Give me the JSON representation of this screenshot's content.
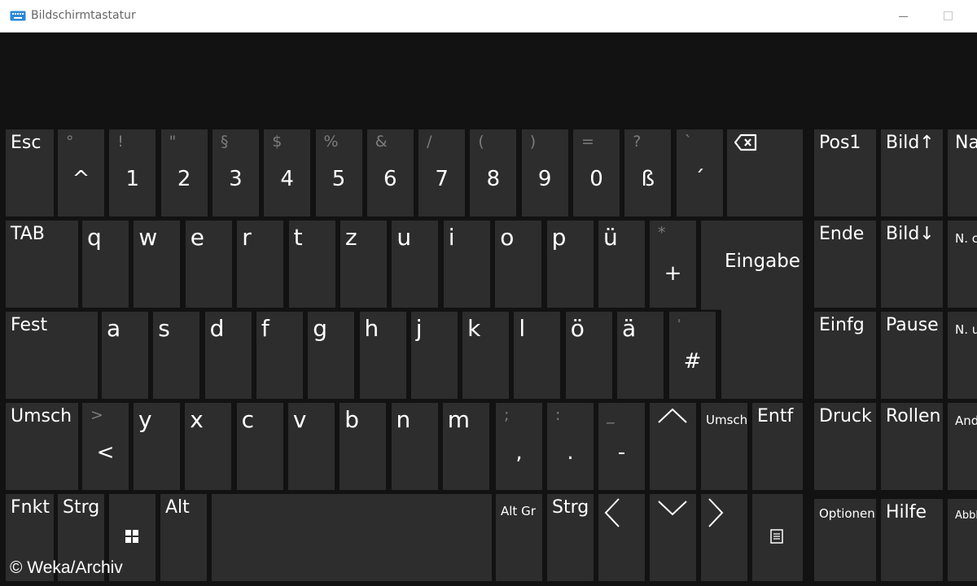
{
  "window": {
    "title": "Bildschirmtastatur",
    "icon": "keyboard-icon"
  },
  "keyboard": {
    "row1": {
      "esc": "Esc",
      "keys": [
        {
          "sec": "°",
          "main": "^"
        },
        {
          "sec": "!",
          "main": "1"
        },
        {
          "sec": "\"",
          "main": "2"
        },
        {
          "sec": "§",
          "main": "3"
        },
        {
          "sec": "$",
          "main": "4"
        },
        {
          "sec": "%",
          "main": "5"
        },
        {
          "sec": "&",
          "main": "6"
        },
        {
          "sec": "/",
          "main": "7"
        },
        {
          "sec": "(",
          "main": "8"
        },
        {
          "sec": ")",
          "main": "9"
        },
        {
          "sec": "=",
          "main": "0"
        },
        {
          "sec": "?",
          "main": "ß"
        },
        {
          "sec": "`",
          "main": "´"
        }
      ],
      "backspace_icon": "backspace-icon"
    },
    "row2": {
      "tab": "TAB",
      "letters": [
        "q",
        "w",
        "e",
        "r",
        "t",
        "z",
        "u",
        "i",
        "o",
        "p",
        "ü"
      ],
      "plus": {
        "sec": "*",
        "main": "+"
      },
      "enter": "Eingabe"
    },
    "row3": {
      "caps": "Fest",
      "letters": [
        "a",
        "s",
        "d",
        "f",
        "g",
        "h",
        "j",
        "k",
        "l",
        "ö",
        "ä"
      ],
      "hash": {
        "sec": "'",
        "main": "#"
      }
    },
    "row4": {
      "shift_left": "Umsch",
      "angle": {
        "sec": ">",
        "main": "<"
      },
      "letters": [
        "y",
        "x",
        "c",
        "v",
        "b",
        "n",
        "m"
      ],
      "punct": [
        {
          "sec": ";",
          "main": ","
        },
        {
          "sec": ":",
          "main": "."
        },
        {
          "sec": "_",
          "main": "-"
        }
      ],
      "up_icon": "arrow-up-icon",
      "shift_right": "Umsch",
      "delete": "Entf"
    },
    "row5": {
      "fn": "Fnkt",
      "ctrl_left": "Strg",
      "win_icon": "windows-icon",
      "alt": "Alt",
      "altgr": "Alt Gr",
      "ctrl_right": "Strg",
      "left_icon": "arrow-left-icon",
      "down_icon": "arrow-down-icon",
      "right_icon": "arrow-right-icon",
      "menu_icon": "context-menu-icon"
    },
    "nav": {
      "pos1": "Pos1",
      "bild_up": "Bild↑",
      "na": "Na",
      "ende": "Ende",
      "bild_down": "Bild↓",
      "nc1": "N. c",
      "einfg": "Einfg",
      "pause": "Pause",
      "nc2": "N. u",
      "druck": "Druck",
      "rollen": "Rollen",
      "and": "And",
      "optionen": "Optionen",
      "hilfe": "Hilfe",
      "abbl": "Abbl"
    }
  },
  "watermark": "© Weka/Archiv",
  "colors": {
    "background": "#121212",
    "key": "#2d2d2d",
    "secondary": "#7c7c7c",
    "text": "#ffffff"
  }
}
